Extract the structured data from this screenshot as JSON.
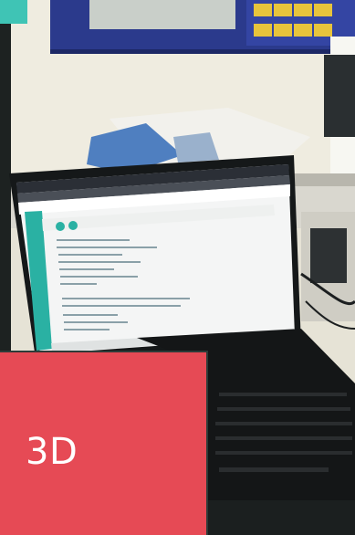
{
  "overlay": {
    "label": "3D"
  },
  "photo": {
    "subject": "laptop-with-code-editor-on-desk"
  },
  "colors": {
    "tile": "#e64a55",
    "editor_sidebar": "#2ab1a3",
    "frame": "#1f2524"
  }
}
